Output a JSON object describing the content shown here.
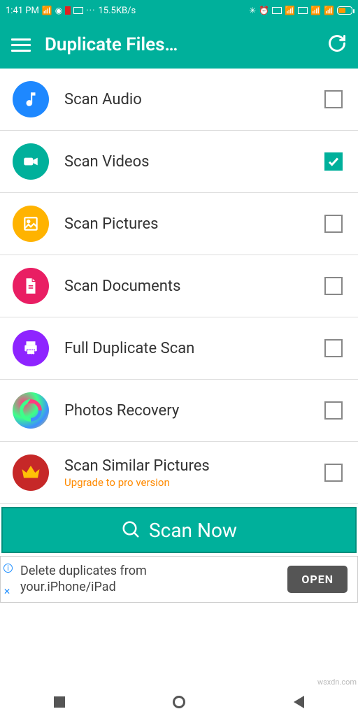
{
  "statusbar": {
    "time": "1:41 PM",
    "net_speed": "15.5KB/s"
  },
  "appbar": {
    "title": "Duplicate Files…"
  },
  "items": [
    {
      "label": "Scan Audio",
      "icon": "music-note-icon",
      "bg": "bg-blue",
      "checked": false
    },
    {
      "label": "Scan Videos",
      "icon": "video-icon",
      "bg": "bg-teal",
      "checked": true
    },
    {
      "label": "Scan Pictures",
      "icon": "picture-icon",
      "bg": "bg-amber",
      "checked": false
    },
    {
      "label": "Scan Documents",
      "icon": "document-icon",
      "bg": "bg-pink",
      "checked": false
    },
    {
      "label": "Full Duplicate Scan",
      "icon": "printer-icon",
      "bg": "bg-purple",
      "checked": false
    },
    {
      "label": "Photos Recovery",
      "icon": "recovery-icon",
      "bg": "bg-grad",
      "checked": false
    },
    {
      "label": "Scan Similar Pictures",
      "icon": "crown-icon",
      "bg": "bg-crown",
      "checked": false,
      "sublabel": "Upgrade to pro version"
    }
  ],
  "scan_button": "Scan Now",
  "ad": {
    "line1": "Delete duplicates from",
    "line2": "your.iPhone/iPad",
    "cta": "OPEN"
  },
  "watermark": "wsxdn.com"
}
